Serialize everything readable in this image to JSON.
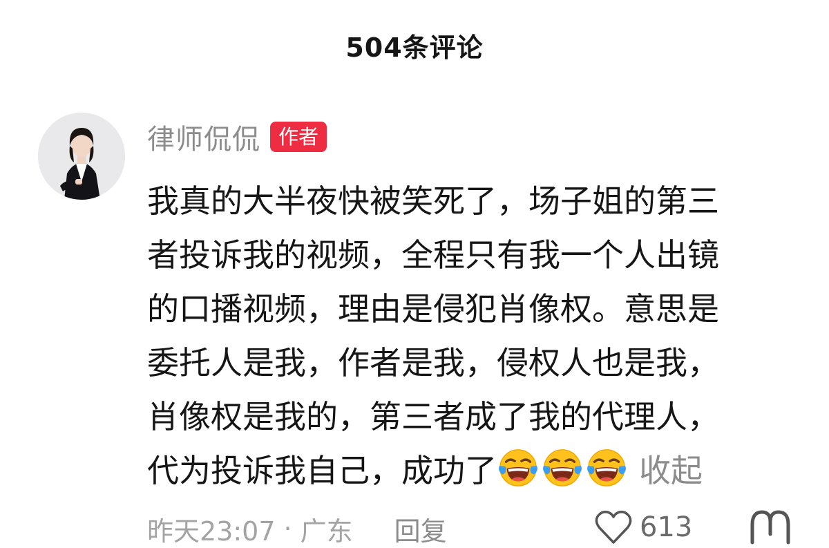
{
  "header": {
    "title": "504条评论"
  },
  "comment": {
    "author": "律师侃侃",
    "author_badge": "作者",
    "lines": [
      "我真的大半夜快被笑死了，场子姐的第三",
      "者投诉我的视频，全程只有我一个人出镜",
      "的口播视频，理由是侵犯肖像权。意思是",
      "委托人是我，作者是我，侵权人也是我，",
      "肖像权是我的，第三者成了我的代理人，"
    ],
    "last_line_text": "代为投诉我自己，成功了",
    "emojis": [
      "tears-of-joy-emoji",
      "tears-of-joy-emoji",
      "tears-of-joy-emoji"
    ],
    "collapse_label": "收起",
    "time": "昨天23:07",
    "separator": "·",
    "location": "广东",
    "reply_label": "回复",
    "like_count": "613"
  },
  "icons": {
    "like": "heart-outline-icon",
    "dislike": "thumbs-down-icon"
  },
  "colors": {
    "badge": "#ee2d43",
    "muted_text": "#8c8c8c",
    "emoji_face": "#ffc21c",
    "emoji_tears": "#3a9ef0"
  }
}
